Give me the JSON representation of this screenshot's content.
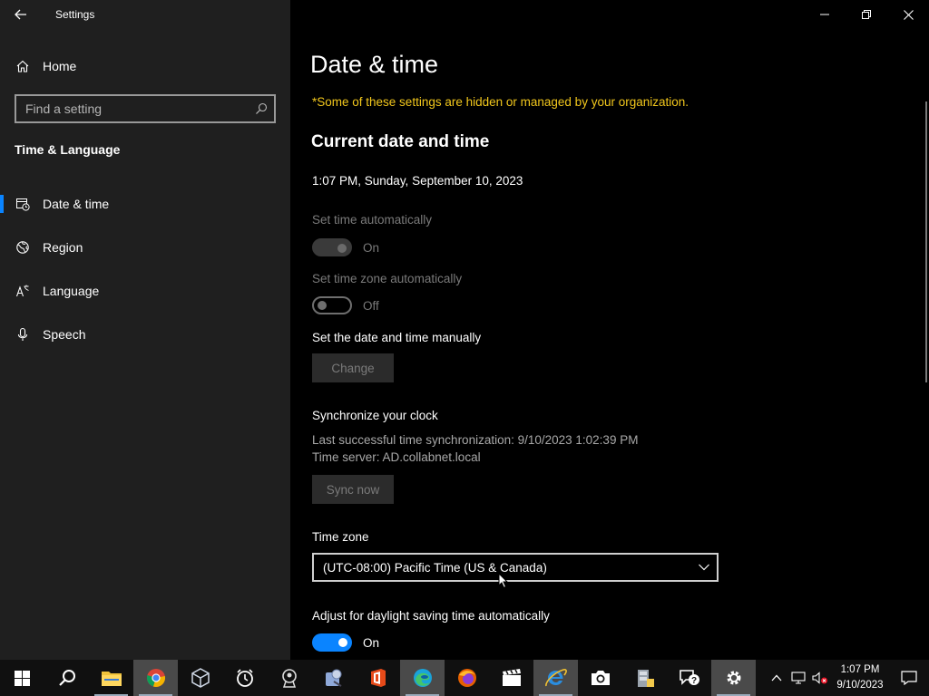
{
  "window": {
    "app_title": "Settings"
  },
  "sidebar": {
    "home_label": "Home",
    "search_placeholder": "Find a setting",
    "section_title": "Time & Language",
    "items": [
      {
        "label": "Date & time",
        "icon": "clock-calendar-icon",
        "active": true
      },
      {
        "label": "Region",
        "icon": "globe-icon",
        "active": false
      },
      {
        "label": "Language",
        "icon": "language-icon",
        "active": false
      },
      {
        "label": "Speech",
        "icon": "microphone-icon",
        "active": false
      }
    ]
  },
  "main": {
    "page_title": "Date & time",
    "org_note": "*Some of these settings are hidden or managed by your organization.",
    "current_heading": "Current date and time",
    "current_datetime": "1:07 PM, Sunday, September 10, 2023",
    "set_time_auto": {
      "label": "Set time automatically",
      "state": "On"
    },
    "set_zone_auto": {
      "label": "Set time zone automatically",
      "state": "Off"
    },
    "manual": {
      "label": "Set the date and time manually",
      "button": "Change"
    },
    "sync": {
      "heading": "Synchronize your clock",
      "last_sync": "Last successful time synchronization: 9/10/2023 1:02:39 PM",
      "server": "Time server: AD.collabnet.local",
      "button": "Sync now"
    },
    "timezone": {
      "label": "Time zone",
      "value": "(UTC-08:00) Pacific Time (US & Canada)"
    },
    "dst": {
      "label": "Adjust for daylight saving time automatically",
      "state": "On"
    }
  },
  "taskbar": {
    "clock_time": "1:07 PM",
    "clock_date": "9/10/2023"
  },
  "colors": {
    "accent": "#0a84ff",
    "org_note": "#f2c71c",
    "sidebar_bg": "#1f1f1f",
    "content_bg": "#000000"
  }
}
